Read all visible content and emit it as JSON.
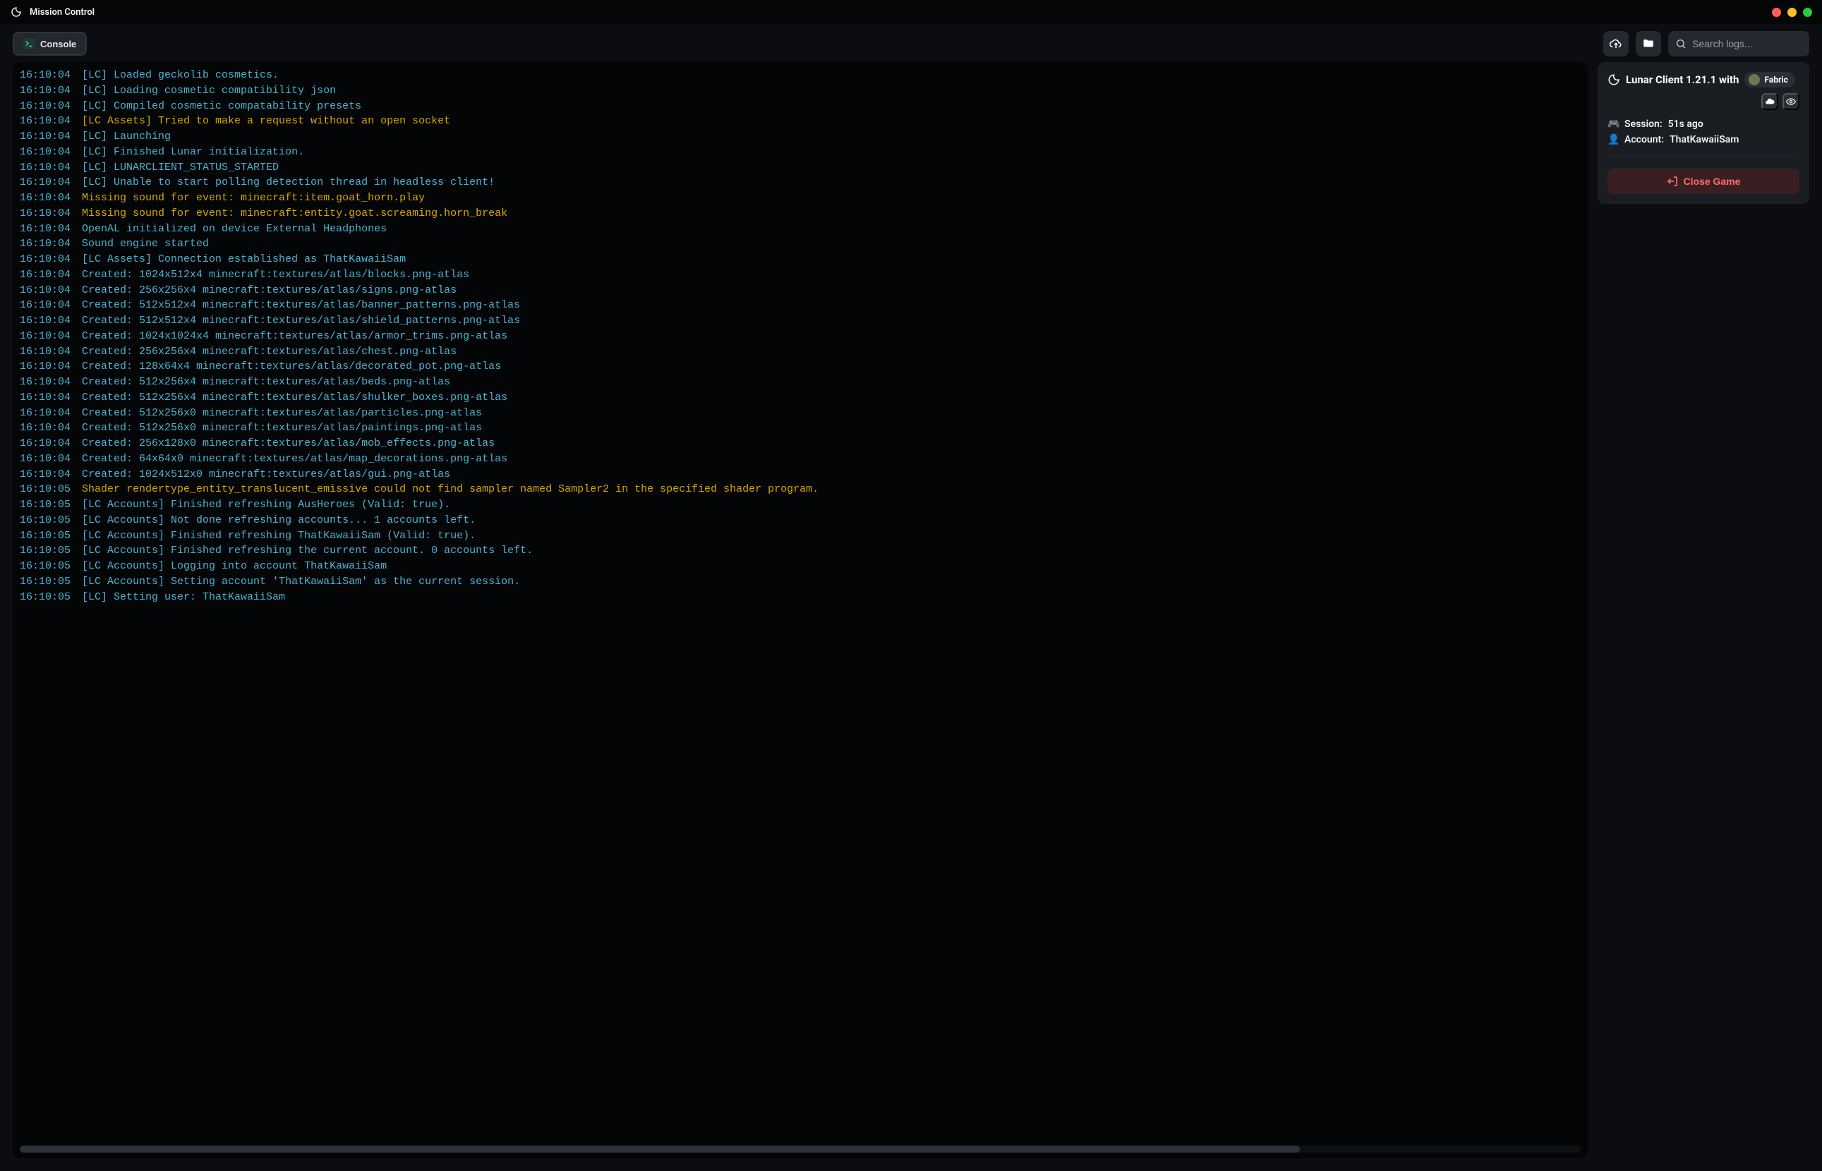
{
  "app": {
    "title": "Mission Control"
  },
  "toolbar": {
    "console_label": "Console",
    "search_placeholder": "Search logs..."
  },
  "sidebar": {
    "title_prefix": "Lunar Client",
    "version": "1.21.1",
    "with_label": "with",
    "mod_loader": "Fabric",
    "session_label": "Session:",
    "session_value": "51s ago",
    "account_label": "Account:",
    "account_value": "ThatKawaiiSam",
    "close_label": "Close Game"
  },
  "logs": [
    {
      "ts": "16:10:04",
      "level": "info",
      "msg": "[LC] Loaded geckolib cosmetics."
    },
    {
      "ts": "16:10:04",
      "level": "info",
      "msg": "[LC] Loading cosmetic compatibility json"
    },
    {
      "ts": "16:10:04",
      "level": "info",
      "msg": "[LC] Compiled cosmetic compatability presets"
    },
    {
      "ts": "16:10:04",
      "level": "warn",
      "msg": "[LC Assets] Tried to make a request without an open socket"
    },
    {
      "ts": "16:10:04",
      "level": "info",
      "msg": "[LC] Launching"
    },
    {
      "ts": "16:10:04",
      "level": "info",
      "msg": "[LC] Finished Lunar initialization."
    },
    {
      "ts": "16:10:04",
      "level": "info",
      "msg": "[LC] LUNARCLIENT_STATUS_STARTED"
    },
    {
      "ts": "16:10:04",
      "level": "info",
      "msg": "[LC] Unable to start polling detection thread in headless client!"
    },
    {
      "ts": "16:10:04",
      "level": "warn",
      "msg": "Missing sound for event: minecraft:item.goat_horn.play"
    },
    {
      "ts": "16:10:04",
      "level": "warn",
      "msg": "Missing sound for event: minecraft:entity.goat.screaming.horn_break"
    },
    {
      "ts": "16:10:04",
      "level": "info",
      "msg": "OpenAL initialized on device External Headphones"
    },
    {
      "ts": "16:10:04",
      "level": "info",
      "msg": "Sound engine started"
    },
    {
      "ts": "16:10:04",
      "level": "info",
      "msg": "[LC Assets] Connection established as ThatKawaiiSam"
    },
    {
      "ts": "16:10:04",
      "level": "info",
      "msg": "Created: 1024x512x4 minecraft:textures/atlas/blocks.png-atlas"
    },
    {
      "ts": "16:10:04",
      "level": "info",
      "msg": "Created: 256x256x4 minecraft:textures/atlas/signs.png-atlas"
    },
    {
      "ts": "16:10:04",
      "level": "info",
      "msg": "Created: 512x512x4 minecraft:textures/atlas/banner_patterns.png-atlas"
    },
    {
      "ts": "16:10:04",
      "level": "info",
      "msg": "Created: 512x512x4 minecraft:textures/atlas/shield_patterns.png-atlas"
    },
    {
      "ts": "16:10:04",
      "level": "info",
      "msg": "Created: 1024x1024x4 minecraft:textures/atlas/armor_trims.png-atlas"
    },
    {
      "ts": "16:10:04",
      "level": "info",
      "msg": "Created: 256x256x4 minecraft:textures/atlas/chest.png-atlas"
    },
    {
      "ts": "16:10:04",
      "level": "info",
      "msg": "Created: 128x64x4 minecraft:textures/atlas/decorated_pot.png-atlas"
    },
    {
      "ts": "16:10:04",
      "level": "info",
      "msg": "Created: 512x256x4 minecraft:textures/atlas/beds.png-atlas"
    },
    {
      "ts": "16:10:04",
      "level": "info",
      "msg": "Created: 512x256x4 minecraft:textures/atlas/shulker_boxes.png-atlas"
    },
    {
      "ts": "16:10:04",
      "level": "info",
      "msg": "Created: 512x256x0 minecraft:textures/atlas/particles.png-atlas"
    },
    {
      "ts": "16:10:04",
      "level": "info",
      "msg": "Created: 512x256x0 minecraft:textures/atlas/paintings.png-atlas"
    },
    {
      "ts": "16:10:04",
      "level": "info",
      "msg": "Created: 256x128x0 minecraft:textures/atlas/mob_effects.png-atlas"
    },
    {
      "ts": "16:10:04",
      "level": "info",
      "msg": "Created: 64x64x0 minecraft:textures/atlas/map_decorations.png-atlas"
    },
    {
      "ts": "16:10:04",
      "level": "info",
      "msg": "Created: 1024x512x0 minecraft:textures/atlas/gui.png-atlas"
    },
    {
      "ts": "16:10:05",
      "level": "warn",
      "msg": "Shader rendertype_entity_translucent_emissive could not find sampler named Sampler2 in the specified shader program."
    },
    {
      "ts": "16:10:05",
      "level": "info",
      "msg": "[LC Accounts] Finished refreshing AusHeroes (Valid: true)."
    },
    {
      "ts": "16:10:05",
      "level": "info",
      "msg": "[LC Accounts] Not done refreshing accounts... 1 accounts left."
    },
    {
      "ts": "16:10:05",
      "level": "info",
      "msg": "[LC Accounts] Finished refreshing ThatKawaiiSam (Valid: true)."
    },
    {
      "ts": "16:10:05",
      "level": "info",
      "msg": "[LC Accounts] Finished refreshing the current account. 0 accounts left."
    },
    {
      "ts": "16:10:05",
      "level": "info",
      "msg": "[LC Accounts] Logging into account ThatKawaiiSam"
    },
    {
      "ts": "16:10:05",
      "level": "info",
      "msg": "[LC Accounts] Setting account 'ThatKawaiiSam' as the current session."
    },
    {
      "ts": "16:10:05",
      "level": "info",
      "msg": "[LC] Setting user: ThatKawaiiSam"
    }
  ]
}
